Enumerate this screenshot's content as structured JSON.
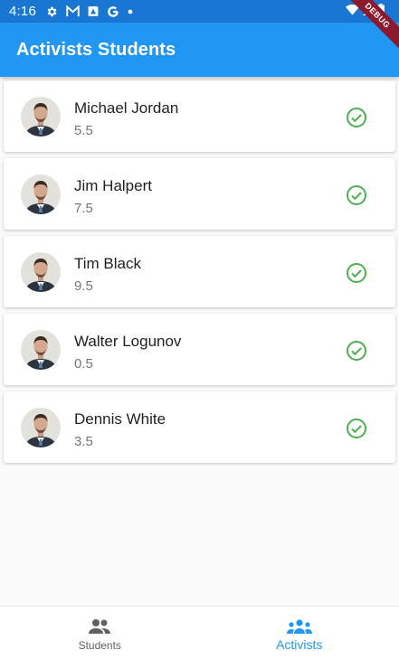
{
  "status_bar": {
    "time": "4:16",
    "icons": [
      "settings-icon",
      "gmail-icon",
      "notification-icon",
      "google-icon",
      "dot-icon"
    ],
    "right_icons": [
      "wifi-icon",
      "signal-icon",
      "battery-icon"
    ]
  },
  "debug_banner": "DEBUG",
  "app_bar": {
    "title": "Activists Students"
  },
  "students": [
    {
      "name": "Michael Jordan",
      "score": "5.5"
    },
    {
      "name": "Jim Halpert",
      "score": "7.5"
    },
    {
      "name": "Tim Black",
      "score": "9.5"
    },
    {
      "name": "Walter Logunov",
      "score": "0.5"
    },
    {
      "name": "Dennis White",
      "score": "3.5"
    }
  ],
  "bottom_nav": {
    "items": [
      {
        "label": "Students",
        "icon": "people-icon",
        "active": false
      },
      {
        "label": "Activists",
        "icon": "groups-icon",
        "active": true
      }
    ]
  },
  "colors": {
    "status_bar": "#1976d2",
    "app_bar": "#2196f3",
    "check": "#4caf50",
    "active_nav": "#2196f3"
  }
}
